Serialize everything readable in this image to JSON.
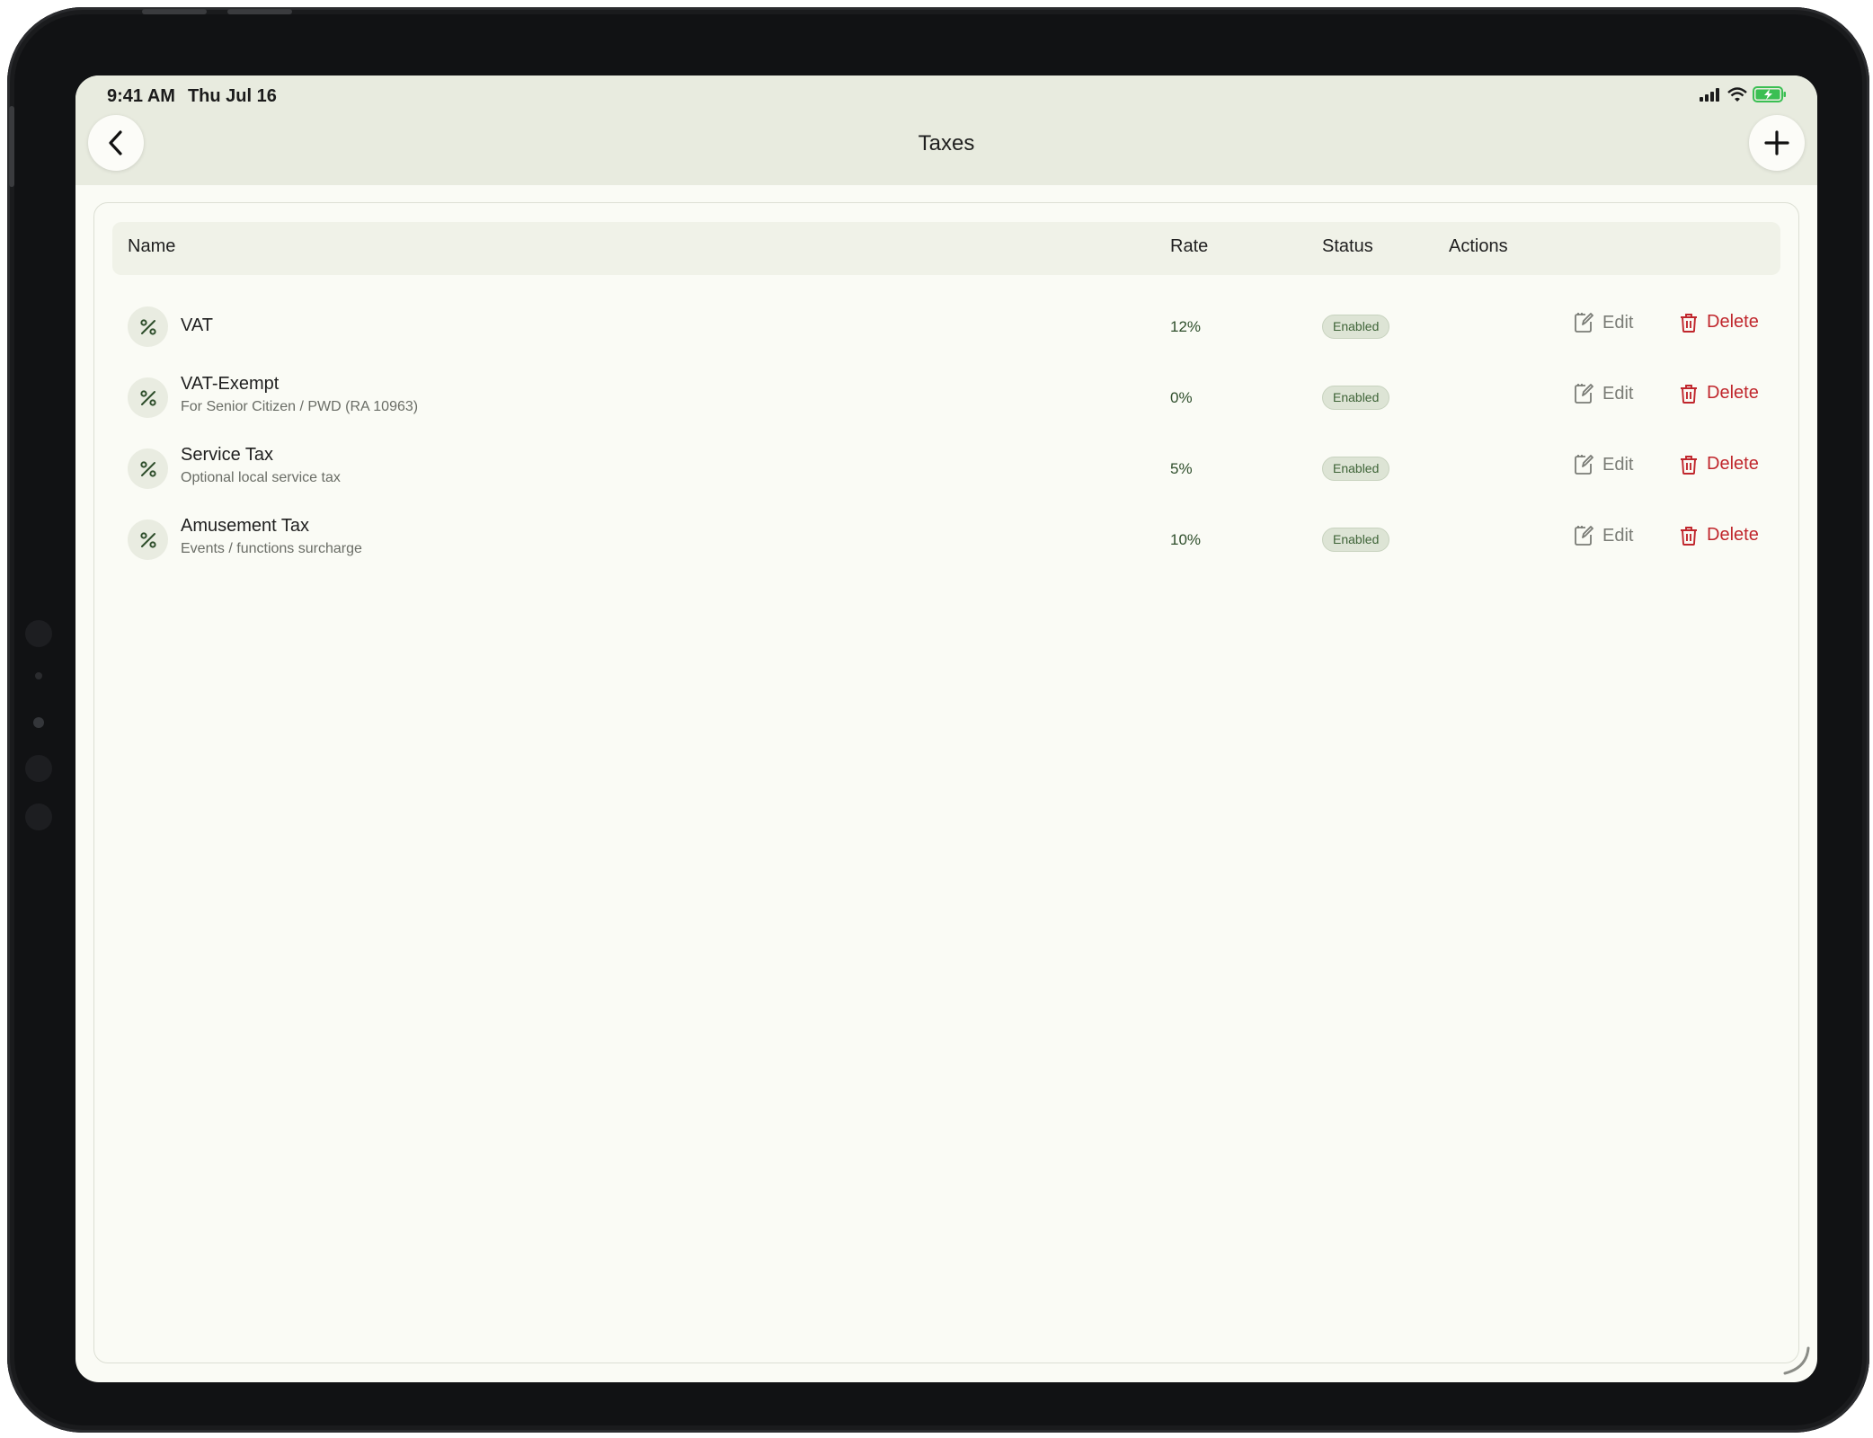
{
  "status_bar": {
    "time": "9:41 AM",
    "date": "Thu Jul 16"
  },
  "header": {
    "title": "Taxes"
  },
  "table": {
    "columns": {
      "name": "Name",
      "rate": "Rate",
      "status": "Status",
      "actions": "Actions"
    },
    "actions": {
      "edit": "Edit",
      "delete": "Delete"
    },
    "rows": [
      {
        "name": "VAT",
        "subtitle": "",
        "rate": "12%",
        "status": "Enabled"
      },
      {
        "name": "VAT-Exempt",
        "subtitle": "For Senior Citizen / PWD (RA 10963)",
        "rate": "0%",
        "status": "Enabled"
      },
      {
        "name": "Service Tax",
        "subtitle": "Optional local service tax",
        "rate": "5%",
        "status": "Enabled"
      },
      {
        "name": "Amusement Tax",
        "subtitle": "Events / functions surcharge",
        "rate": "10%",
        "status": "Enabled"
      }
    ]
  },
  "icons": {
    "back": "chevron-left-icon",
    "add": "plus-icon",
    "row": "percent-icon",
    "edit": "edit-icon",
    "delete": "trash-icon",
    "signal": "signal-icon",
    "wifi": "wifi-icon",
    "battery": "battery-charging-icon"
  },
  "colors": {
    "accent": "#3f6438",
    "delete": "#c0262c",
    "header_bg": "#e8ebdf",
    "page_bg": "#fafbf5"
  }
}
